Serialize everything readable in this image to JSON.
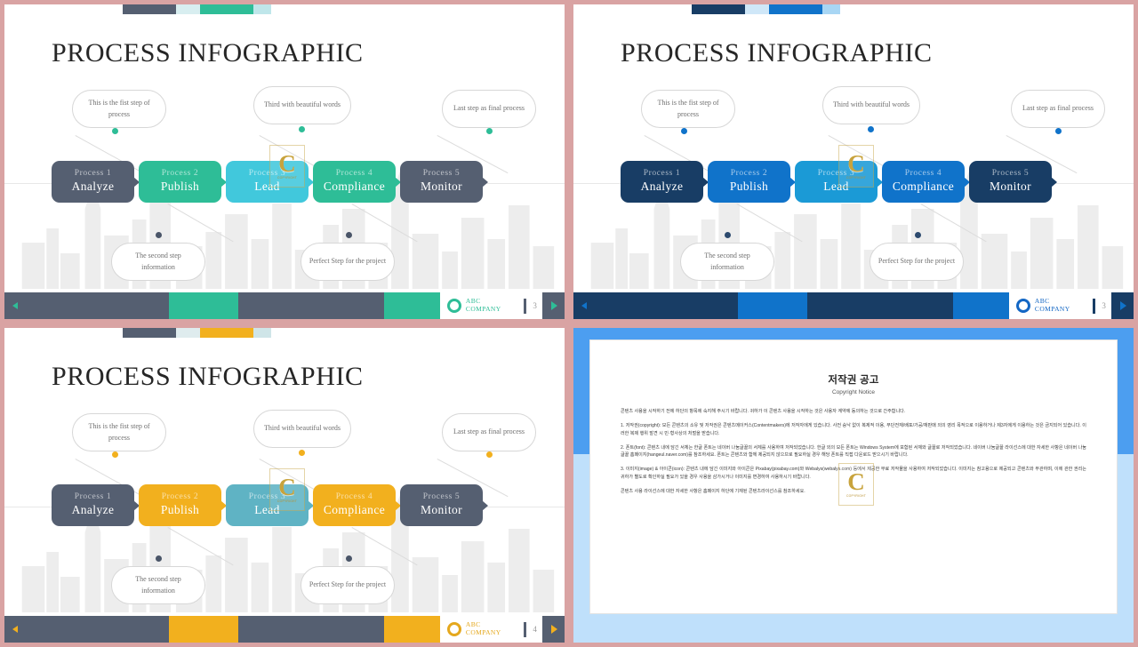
{
  "deck": {
    "slide_title": "PROCESS INFOGRAPHIC",
    "logo_line1": "ABC",
    "logo_line2": "COMPANY",
    "nav_prev_icon": "chevron-left-icon",
    "nav_next_icon": "chevron-right-icon",
    "watermark_glyph": "C",
    "watermark_sub": "COPYRIGHT"
  },
  "process_steps": [
    {
      "top": "Process 1",
      "main": "Analyze"
    },
    {
      "top": "Process 2",
      "main": "Publish"
    },
    {
      "top": "Process 3",
      "main": "Lead"
    },
    {
      "top": "Process 4",
      "main": "Compliance"
    },
    {
      "top": "Process 5",
      "main": "Monitor"
    }
  ],
  "callouts": {
    "above": [
      "This is the fist step of process",
      "Third with beautiful words",
      "Last step as final process"
    ],
    "below": [
      "The second step information",
      "Perfect Step for the project"
    ]
  },
  "slides": [
    {
      "id": "slide-green",
      "page_number": "3",
      "accent": "#2ebd97",
      "dark": "#555f71",
      "light": "#41c8dc",
      "logo_color": "#2ebd97",
      "topbars": [
        "#555f71",
        "#d8eef0",
        "#2ebd97",
        "#bfe6ea"
      ],
      "box_colors": [
        "#555f71",
        "#2ebd97",
        "#41c8dc",
        "#2ebd97",
        "#555f71"
      ],
      "dot_above": "#2ebd97",
      "dot_below": "#4a5568",
      "footer_segments": [
        "#555f71",
        "#2ebd97",
        "#555f71",
        "#2ebd97"
      ]
    },
    {
      "id": "slide-blue",
      "page_number": "3",
      "accent": "#1073ca",
      "dark": "#183d65",
      "light": "#1b9ad6",
      "logo_color": "#1266c4",
      "topbars": [
        "#183d65",
        "#cfe7f8",
        "#1073ca",
        "#a8d6f4"
      ],
      "box_colors": [
        "#183d65",
        "#1073ca",
        "#1b9ad6",
        "#1073ca",
        "#183d65"
      ],
      "dot_above": "#1073ca",
      "dot_below": "#2c4a6e",
      "footer_segments": [
        "#183d65",
        "#1073ca",
        "#183d65",
        "#1073ca"
      ]
    },
    {
      "id": "slide-yellow",
      "page_number": "4",
      "accent": "#f2b01e",
      "dark": "#555f71",
      "light": "#5fb3c4",
      "logo_color": "#e5a81d",
      "topbars": [
        "#555f71",
        "#dfecee",
        "#f2b01e",
        "#cfe5e8"
      ],
      "box_colors": [
        "#555f71",
        "#f2b01e",
        "#5fb3c4",
        "#f2b01e",
        "#555f71"
      ],
      "dot_above": "#f2b01e",
      "dot_below": "#4a5568",
      "footer_segments": [
        "#555f71",
        "#f2b01e",
        "#555f71",
        "#f2b01e"
      ]
    }
  ],
  "copyright_doc": {
    "title": "저작권 공고",
    "subtitle": "Copyright Notice",
    "paragraphs": [
      "콘텐츠 사용을 시작하기 전에 하단의 항목에 숙지해 주시기 바랍니다. 귀하가 이 콘텐츠 사용을 시작하는 것은 사용자 계약에 동의하는 것으로 간주합니다.",
      "1. 저작권(copyright): 모든 콘텐츠의 소유 및 저작권은 콘텐츠메이커스(Contentmakers)에 저작자에게 있습니다. 사전 승낙 없이 복제적 이용, 무단전재/배포/가공/재판매 외의 영리 목적으로 이용하거나 제3자에게 이용하는 것은 금지되어 있습니다. 이러한 복제 행위 발견 시 민·형사상의 처벌을 받습니다.",
      "2. 폰트(font): 콘텐츠 내에 담긴 서체는 한글 폰트는 네이버 나눔글꼴의 서체를 사용하여 저작되었습니다. 한글 외의 모든 폰트는 Windows System에 포함된 서체와 글꼴로 저작되었습니다. 네이버 나눔글꼴 라이선스에 대한 자세한 사항은 네이버 나눔글꼴 홈페이지(hangeul.naver.com)를 참조하세요. 폰트는 콘텐츠와 함께 제공되지 않으므로 필요하실 경우 해당 폰트를 직접 다운로드 받으시기 바랍니다.",
      "3. 이미지(image) & 아이콘(icon): 콘텐츠 내에 담긴 이미지와 아이콘은 Pixabay(pixabay.com)와 Webalys(webalys.com) 등에서 제공한 무료 저작물을 사용하여 저작되었습니다. 이미지는 참고용으로 제공되고 콘텐츠와 무관하며, 이에 관한 권리는 귀하가 별도로 확인하실 필요가 있을 경우 사용을 삼가시거나 이미지를 변경하여 사용하시기 바랍니다.",
      "콘텐츠 사용 라이선스에 대한 자세한 사항은 홈페이지 하단에 기재된 콘텐츠라이선스를 참조하세요."
    ]
  }
}
